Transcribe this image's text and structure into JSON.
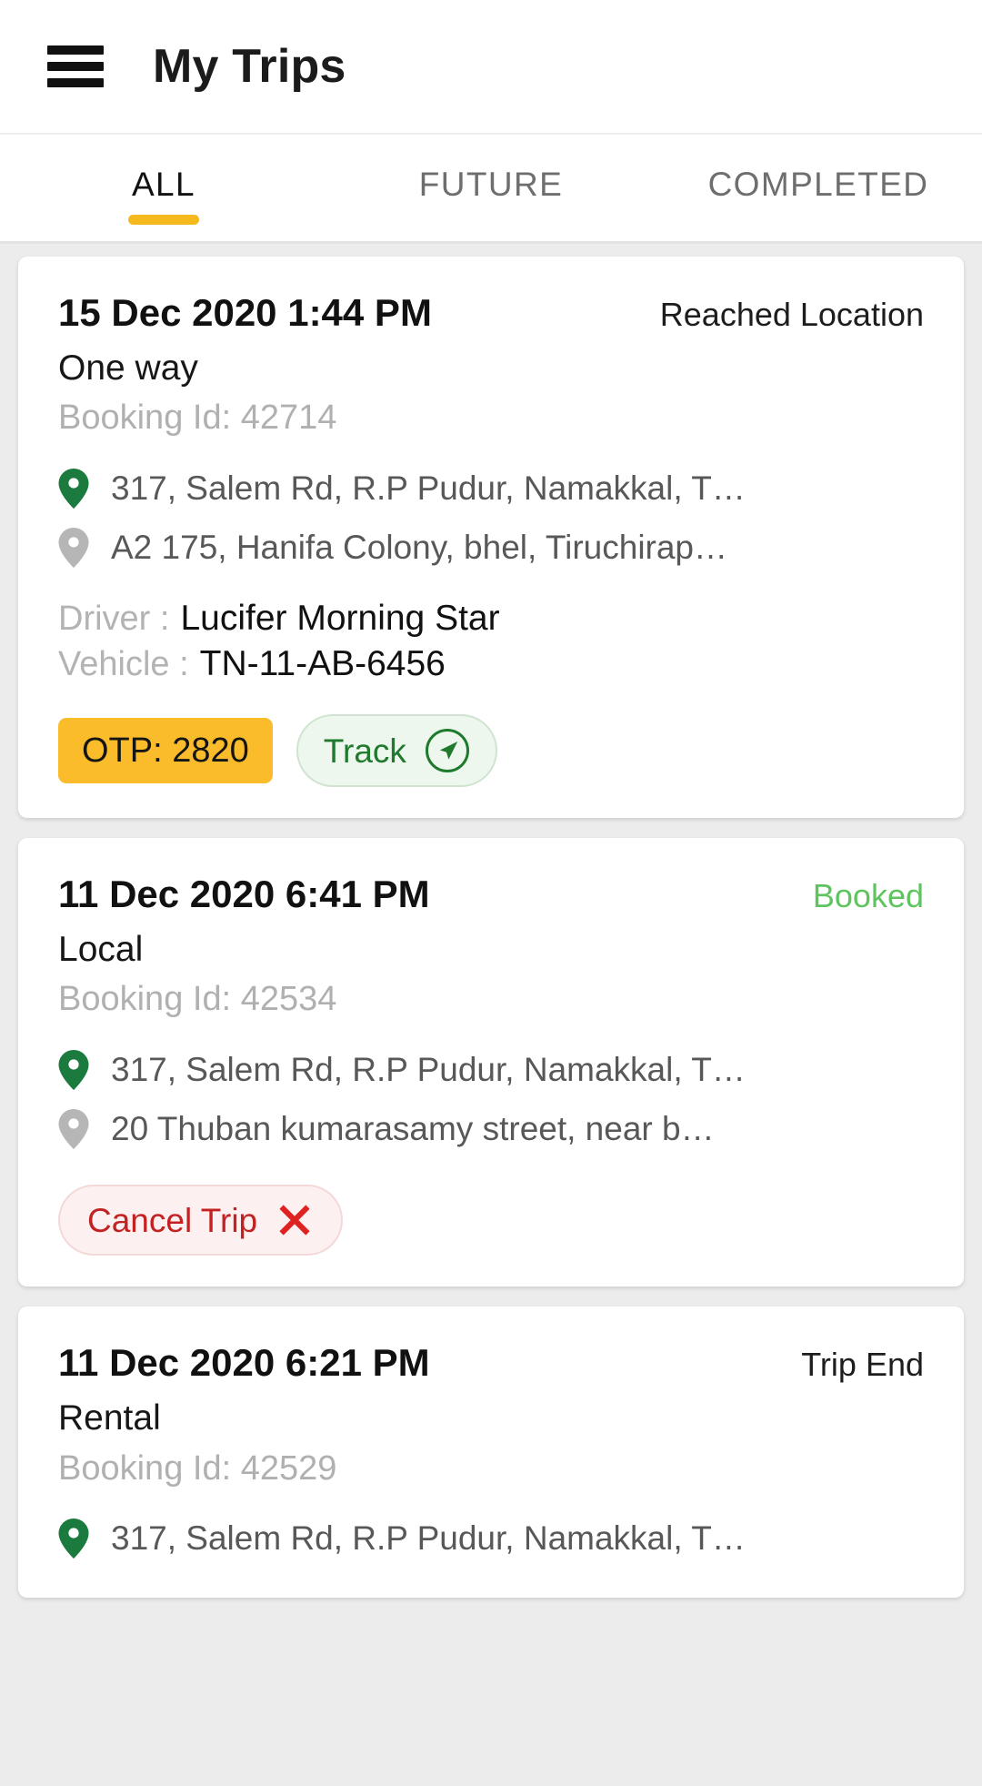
{
  "theme": {
    "accent_yellow": "#F6B91D",
    "otp_badge_bg": "#FBBC2C",
    "track_green": "#1F7A2E",
    "track_bg": "#EEF7EE",
    "booked_green": "#5FC45F",
    "cancel_red": "#C32222",
    "cancel_bg": "#FDF0F0",
    "pin_pickup": "#1B7A3E",
    "pin_drop": "#B6B6B6",
    "page_bg": "#ECECEC",
    "card_bg": "#FFFFFF",
    "muted_text": "#B0B0B0"
  },
  "header": {
    "menu_icon": "hamburger-menu-icon",
    "title": "My Trips"
  },
  "tabs": {
    "active_index": 0,
    "items": [
      {
        "label": "ALL"
      },
      {
        "label": "FUTURE"
      },
      {
        "label": "COMPLETED"
      }
    ]
  },
  "trips": [
    {
      "datetime": "15 Dec 2020 1:44 PM",
      "status": "Reached Location",
      "status_style": "default",
      "trip_type": "One way",
      "booking_id_label": "Booking Id: 42714",
      "pickup": "317, Salem Rd, R.P Pudur, Namakkal, T…",
      "drop": "A2 175, Hanifa Colony, bhel, Tiruchirap…",
      "driver_key": "Driver :",
      "driver_value": "Lucifer Morning Star",
      "vehicle_key": "Vehicle :",
      "vehicle_value": "TN-11-AB-6456",
      "otp_label": "OTP: 2820",
      "track_label": "Track",
      "track_icon": "navigation-arrow-icon"
    },
    {
      "datetime": "11 Dec 2020 6:41 PM",
      "status": "Booked",
      "status_style": "booked",
      "trip_type": "Local",
      "booking_id_label": "Booking Id: 42534",
      "pickup": "317, Salem Rd, R.P Pudur, Namakkal, T…",
      "drop": "20 Thuban kumarasamy street, near b…",
      "cancel_label": "Cancel Trip",
      "cancel_icon": "close-x-icon"
    },
    {
      "datetime": "11 Dec 2020 6:21 PM",
      "status": "Trip End",
      "status_style": "default",
      "trip_type": "Rental",
      "booking_id_label": "Booking Id: 42529",
      "pickup": "317, Salem Rd, R.P Pudur, Namakkal, T…"
    }
  ]
}
